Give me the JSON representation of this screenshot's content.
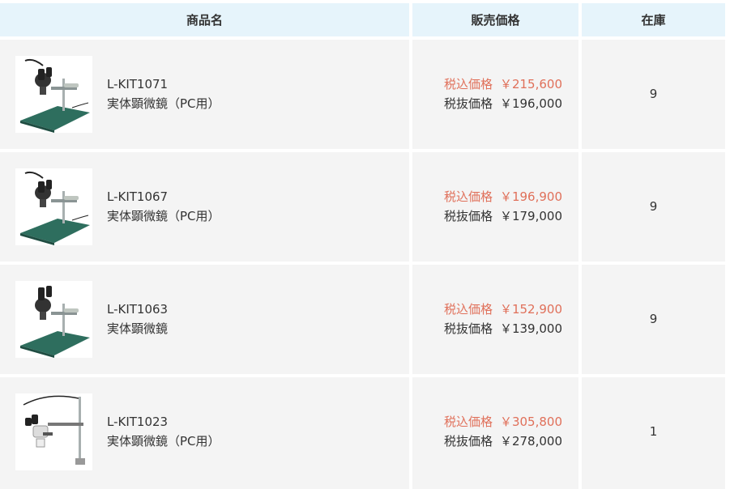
{
  "header": {
    "product_col": "商品名",
    "price_col": "販売価格",
    "stock_col": "在庫"
  },
  "rows": [
    {
      "model": "L-KIT1071",
      "name": "実体顕微鏡（PC用）",
      "tax_in_label": "税込価格",
      "tax_in_price": "￥215,600",
      "tax_ex_label": "税抜価格",
      "tax_ex_price": "￥196,000",
      "stock": "9",
      "image": "microscope-base-stand-image"
    },
    {
      "model": "L-KIT1067",
      "name": "実体顕微鏡（PC用）",
      "tax_in_label": "税込価格",
      "tax_in_price": "￥196,900",
      "tax_ex_label": "税抜価格",
      "tax_ex_price": "￥179,000",
      "stock": "9",
      "image": "microscope-base-stand-image"
    },
    {
      "model": "L-KIT1063",
      "name": "実体顕微鏡",
      "tax_in_label": "税込価格",
      "tax_in_price": "￥152,900",
      "tax_ex_label": "税抜価格",
      "tax_ex_price": "￥139,000",
      "stock": "9",
      "image": "microscope-base-stand-image"
    },
    {
      "model": "L-KIT1023",
      "name": "実体顕微鏡（PC用）",
      "tax_in_label": "税込価格",
      "tax_in_price": "￥305,800",
      "tax_ex_label": "税抜価格",
      "tax_ex_price": "￥278,000",
      "stock": "1",
      "image": "microscope-clamp-arm-image"
    }
  ],
  "colors": {
    "header_bg": "#e6f4fb",
    "row_bg": "#f4f4f4",
    "tax_in_price": "#e0705a",
    "text": "#333333"
  }
}
